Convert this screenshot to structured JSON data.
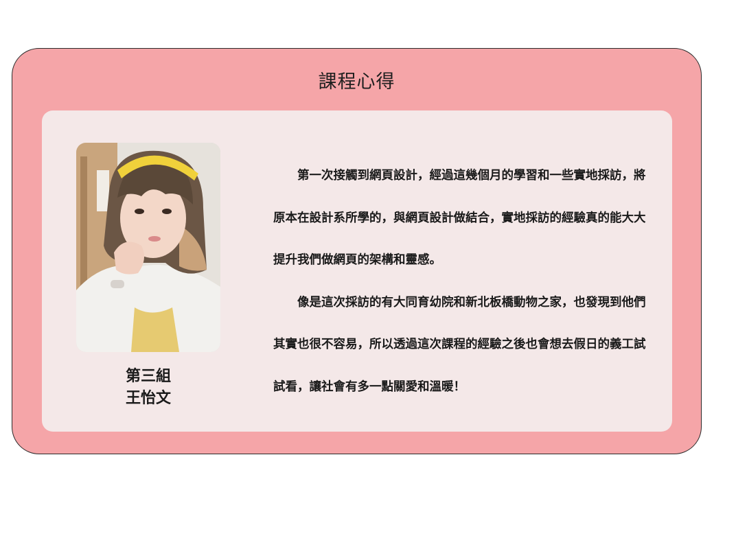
{
  "card": {
    "title": "課程心得"
  },
  "profile": {
    "photo_icon": "portrait-photo",
    "group": "第三組",
    "name": "王怡文"
  },
  "reflection": {
    "paragraphs": [
      "第一次接觸到網頁設計，經過這幾個月的學習和一些實地採訪，將原本在設計系所學的，與網頁設計做結合，實地採訪的經驗真的能大大提升我們做網頁的架構和靈感。",
      "像是這次採訪的有大同育幼院和新北板橋動物之家，也發現到他們其實也很不容易，所以透過這次課程的經驗之後也會想去假日的義工試試看，讓社會有多一點關愛和溫暖！"
    ]
  },
  "colors": {
    "outer_background": "#f5a5a8",
    "inner_background": "#f4e8e8",
    "text": "#1a1a1a"
  }
}
